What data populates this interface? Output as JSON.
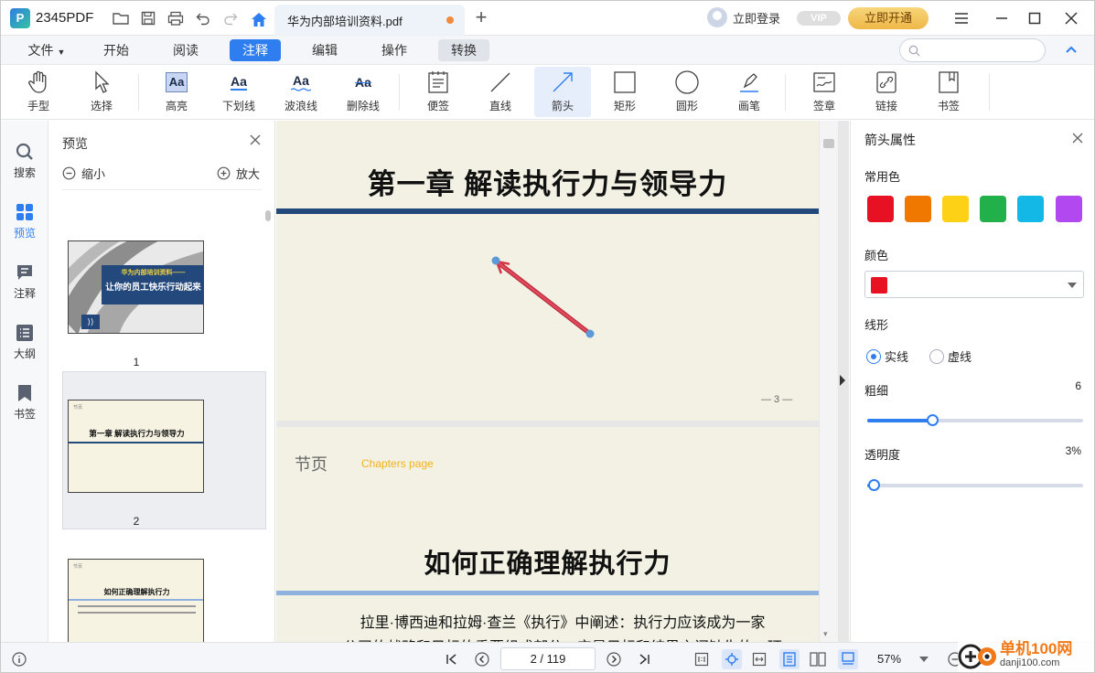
{
  "app": {
    "name": "2345PDF",
    "logo_letter": "P"
  },
  "tab": {
    "title": "华为内部培训资料.pdf"
  },
  "account": {
    "login_label": "立即登录",
    "vip_label": "VIP",
    "open_label": "立即开通"
  },
  "menu": {
    "items": [
      "文件",
      "开始",
      "阅读",
      "注释",
      "编辑",
      "操作",
      "转换"
    ],
    "active": "注释"
  },
  "toolbar": {
    "tools": [
      {
        "label": "手型",
        "icon": "hand-icon"
      },
      {
        "label": "选择",
        "icon": "cursor-icon"
      },
      {
        "label": "高亮",
        "icon": "highlight-icon"
      },
      {
        "label": "下划线",
        "icon": "underline-icon"
      },
      {
        "label": "波浪线",
        "icon": "wavy-underline-icon"
      },
      {
        "label": "删除线",
        "icon": "strikethrough-icon"
      },
      {
        "label": "便签",
        "icon": "sticky-note-icon"
      },
      {
        "label": "直线",
        "icon": "line-icon"
      },
      {
        "label": "箭头",
        "icon": "arrow-icon"
      },
      {
        "label": "矩形",
        "icon": "rectangle-icon"
      },
      {
        "label": "圆形",
        "icon": "circle-icon"
      },
      {
        "label": "画笔",
        "icon": "pen-icon"
      },
      {
        "label": "签章",
        "icon": "stamp-icon"
      },
      {
        "label": "链接",
        "icon": "link-icon"
      },
      {
        "label": "书签",
        "icon": "bookmark-icon"
      }
    ],
    "active": "箭头",
    "aa_glyph": "Aa"
  },
  "leftnav": {
    "items": [
      "搜索",
      "预览",
      "注释",
      "大纲",
      "书签"
    ],
    "active": "预览"
  },
  "preview": {
    "title": "预览",
    "zoom_out": "缩小",
    "zoom_in": "放大",
    "thumbs": [
      {
        "number": "1",
        "banner_top": "华为内部培训资料——",
        "banner_main": "让你的员工快乐行动起来",
        "badge": "⟩⟩"
      },
      {
        "number": "2",
        "tag": "节页",
        "title": "第一章  解读执行力与领导力"
      },
      {
        "tag": "节页",
        "title": "如何正确理解执行力"
      }
    ]
  },
  "document": {
    "page3": {
      "title": "第一章  解读执行力与领导力",
      "page_number": "— 3 —"
    },
    "page4": {
      "tag": "节页",
      "tag_en": "Chapters page",
      "title": "如何正确理解执行力",
      "line1": "拉里·博西迪和拉姆·查兰《执行》中阐述：执行力应该成为一家",
      "line2": "公司的战略和目标的重要组成部分，它是目标和结果之间缺失的一环"
    }
  },
  "properties": {
    "title": "箭头属性",
    "common_colors_label": "常用色",
    "common_colors": [
      "#e81123",
      "#f07800",
      "#fcd116",
      "#22b04a",
      "#14b8e6",
      "#b148f0"
    ],
    "color_label": "颜色",
    "selected_color": "#e81123",
    "line_style_label": "线形",
    "line_styles": [
      "实线",
      "虚线"
    ],
    "line_style_selected": "实线",
    "thickness_label": "粗细",
    "thickness": "6",
    "thickness_fraction": 0.3,
    "opacity_label": "透明度",
    "opacity": "3%",
    "opacity_fraction": 0.03
  },
  "status": {
    "page": "2 / 119",
    "zoom": "57%"
  },
  "watermark": {
    "text": "单机100网",
    "url": "danji100.com"
  },
  "colors": {
    "accent": "#2f7ef0",
    "arrow": "#d23a4c",
    "navy": "#23497c"
  }
}
